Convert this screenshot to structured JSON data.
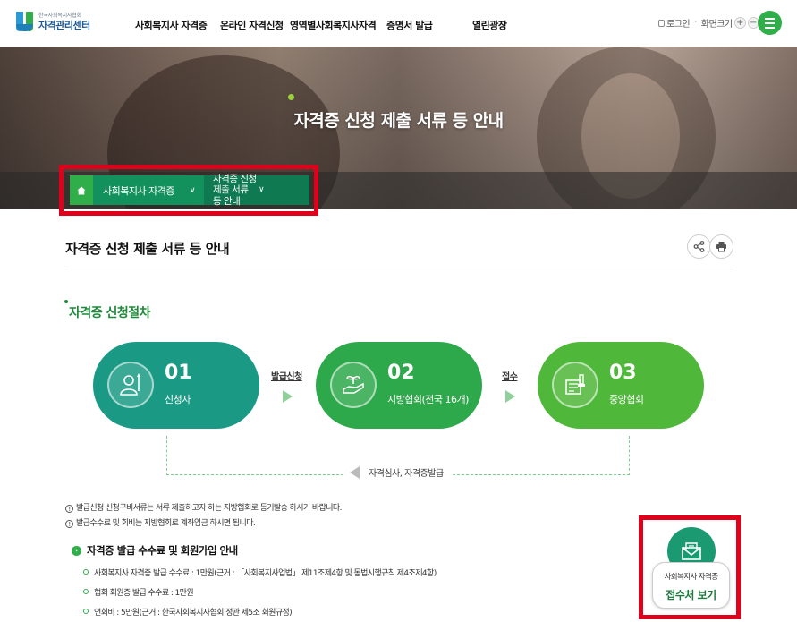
{
  "header": {
    "logo_sub": "한국사회복지사협회",
    "logo_main": "자격관리센터",
    "nav": [
      "사회복지사 자격증",
      "온라인 자격신청",
      "영역별사회복지사자격",
      "증명서 발급",
      "열린광장"
    ],
    "login": "로그인",
    "zoom_label": "화면크기",
    "zoom_in": "+",
    "zoom_out": "−"
  },
  "hero": {
    "title": "자격증 신청 제출 서류 등 안내"
  },
  "breadcrumb": {
    "items": [
      "사회복지사 자격증",
      "자격증 신청 제출 서류 등 안내"
    ]
  },
  "page": {
    "title": "자격증 신청 제출 서류 등 안내"
  },
  "procedure": {
    "title": "자격증 신청절차",
    "steps": [
      {
        "num": "01",
        "label": "신청자"
      },
      {
        "num": "02",
        "label": "지방협회(전국 16개)"
      },
      {
        "num": "03",
        "label": "중앙협회"
      }
    ],
    "arrows": [
      "발급신청",
      "접수"
    ],
    "review": "자격심사, 자격증발급"
  },
  "notes": [
    "발급신청 신청구비서류는 서류 제출하고자 하는 지방협회로 등기발송 하시기 바랍니다.",
    "발급수수료 및 회비는 지방협회로 계좌입금 하시면 됩니다."
  ],
  "fee": {
    "title": "자격증 발급 수수료 및 회원가입 안내",
    "items": [
      "사회복지사 자격증 발급 수수료 : 1만원(근거 : 「사회복지사업법」 제11조제4항 및 동법시행규칙 제4조제4항)",
      "협회 회원증 발급 수수료 : 1만원",
      "연회비 : 5만원(근거 : 한국사회복지사협회 정관 제5조 회원규정)"
    ]
  },
  "receipt": {
    "line1": "사회복지사 자격증",
    "line2": "접수처 보기"
  },
  "colors": {
    "teal": "#1a9a85",
    "green": "#2da84a",
    "lime": "#4fb739",
    "highlight": "#e0001b"
  }
}
